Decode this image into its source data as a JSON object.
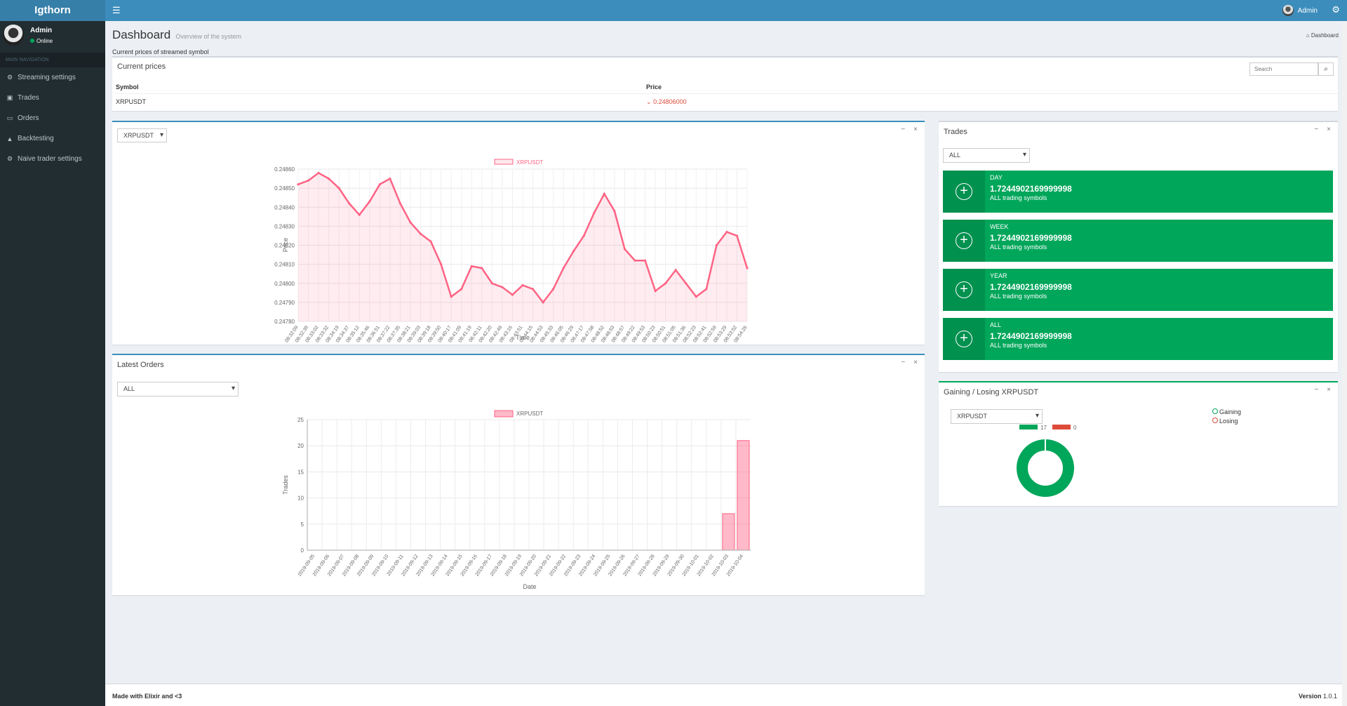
{
  "app": {
    "logo": "Igthorn",
    "user": "Admin"
  },
  "sidebar": {
    "user_name": "Admin",
    "status": "Online",
    "nav_header": "MAIN NAVIGATION",
    "items": [
      {
        "label": "Streaming settings",
        "icon": "gear-icon"
      },
      {
        "label": "Trades",
        "icon": "money-icon"
      },
      {
        "label": "Orders",
        "icon": "card-icon"
      },
      {
        "label": "Backtesting",
        "icon": "flask-icon"
      },
      {
        "label": "Naive trader settings",
        "icon": "gear-icon"
      }
    ]
  },
  "header": {
    "title": "Dashboard",
    "subtitle": "Overview of the system",
    "breadcrumb": "Dashboard"
  },
  "prices": {
    "section_label": "Current prices of streamed symbol",
    "title": "Current prices",
    "search_placeholder": "Search",
    "col_symbol": "Symbol",
    "col_price": "Price",
    "rows": [
      {
        "symbol": "XRPUSDT",
        "price": "0.24806000"
      }
    ]
  },
  "price_chart": {
    "select": "XRPUSDT"
  },
  "orders_chart": {
    "title": "Latest Orders",
    "select": "ALL"
  },
  "trades": {
    "title": "Trades",
    "select": "ALL",
    "cards": [
      {
        "period": "DAY",
        "value": "1.7244902169999998",
        "note": "ALL trading symbols"
      },
      {
        "period": "WEEK",
        "value": "1.7244902169999998",
        "note": "ALL trading symbols"
      },
      {
        "period": "YEAR",
        "value": "1.7244902169999998",
        "note": "ALL trading symbols"
      },
      {
        "period": "ALL",
        "value": "1.7244902169999998",
        "note": "ALL trading symbols"
      }
    ]
  },
  "gain": {
    "title": "Gaining / Losing XRPUSDT",
    "select": "XRPUSDT",
    "legend_gaining": "Gaining",
    "legend_losing": "Losing"
  },
  "footer": {
    "left": "Made with Elixir and <3",
    "version_label": "Version",
    "version": "1.0.1"
  },
  "colors": {
    "accent": "#3c8dbc",
    "success": "#00a65a",
    "danger": "#dd4b39",
    "line": "#ff6384"
  },
  "chart_data": [
    {
      "type": "line",
      "series": [
        {
          "name": "XRPUSDT"
        }
      ],
      "xlabel": "Time",
      "ylabel": "Price",
      "ylim": [
        0.2478,
        0.2486
      ],
      "yticks": [
        "0.24860",
        "0.24850",
        "0.24840",
        "0.24830",
        "0.24820",
        "0.24810",
        "0.24800",
        "0.24790",
        "0.24780"
      ],
      "x": [
        "08:32:09",
        "08:32:39",
        "08:33:02",
        "08:33:32",
        "08:34:19",
        "08:34:37",
        "08:35:12",
        "08:35:46",
        "08:36:51",
        "08:37:22",
        "08:37:35",
        "08:38:21",
        "08:39:03",
        "08:39:18",
        "08:39:50",
        "08:40:17",
        "08:41:09",
        "08:41:19",
        "08:42:11",
        "08:42:20",
        "08:42:49",
        "08:43:16",
        "08:43:51",
        "08:44:15",
        "08:44:53",
        "08:45:33",
        "08:46:05",
        "08:46:29",
        "08:47:17",
        "08:47:58",
        "08:48:52",
        "08:48:53",
        "08:48:57",
        "08:49:22",
        "08:49:53",
        "08:50:23",
        "08:50:51",
        "08:51:05",
        "08:51:36",
        "08:52:23",
        "08:52:41",
        "08:52:59",
        "08:53:29",
        "08:53:52",
        "08:54:26"
      ],
      "y": [
        0.24852,
        0.24854,
        0.24858,
        0.24855,
        0.2485,
        0.24842,
        0.24836,
        0.24843,
        0.24852,
        0.24855,
        0.24842,
        0.24832,
        0.24826,
        0.24822,
        0.2481,
        0.24793,
        0.24797,
        0.24809,
        0.24808,
        0.248,
        0.24798,
        0.24794,
        0.24799,
        0.24797,
        0.2479,
        0.24797,
        0.24808,
        0.24817,
        0.24825,
        0.24837,
        0.24847,
        0.24838,
        0.24818,
        0.24812,
        0.24812,
        0.24796,
        0.248,
        0.24807,
        0.248,
        0.24793,
        0.24797,
        0.2482,
        0.24827,
        0.24825,
        0.24808
      ]
    },
    {
      "type": "bar",
      "series": [
        {
          "name": "XRPUSDT"
        }
      ],
      "xlabel": "Date",
      "ylabel": "Trades",
      "ylim": [
        0,
        25
      ],
      "yticks": [
        "25",
        "20",
        "15",
        "10",
        "5",
        "0"
      ],
      "categories": [
        "2019-09-05",
        "2019-09-06",
        "2019-09-07",
        "2019-09-08",
        "2019-09-09",
        "2019-09-10",
        "2019-09-11",
        "2019-09-12",
        "2019-09-13",
        "2019-09-14",
        "2019-09-15",
        "2019-09-16",
        "2019-09-17",
        "2019-09-18",
        "2019-09-19",
        "2019-09-20",
        "2019-09-21",
        "2019-09-22",
        "2019-09-23",
        "2019-09-24",
        "2019-09-25",
        "2019-09-26",
        "2019-09-27",
        "2019-09-28",
        "2019-09-29",
        "2019-09-30",
        "2019-10-01",
        "2019-10-02",
        "2019-10-03",
        "2019-10-04"
      ],
      "values": [
        0,
        0,
        0,
        0,
        0,
        0,
        0,
        0,
        0,
        0,
        0,
        0,
        0,
        0,
        0,
        0,
        0,
        0,
        0,
        0,
        0,
        0,
        0,
        0,
        0,
        0,
        0,
        0,
        7,
        21
      ]
    },
    {
      "type": "pie",
      "categories": [
        "Gaining",
        "Losing"
      ],
      "values": [
        17,
        0
      ],
      "labels": [
        "17",
        "0"
      ]
    }
  ]
}
